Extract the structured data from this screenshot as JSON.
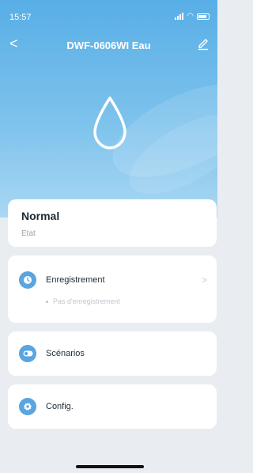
{
  "status_bar": {
    "time": "15:57"
  },
  "header": {
    "back_label": "<",
    "title": "DWF-0606WI Eau"
  },
  "device_icon": "water-drop-icon",
  "state_card": {
    "value": "Normal",
    "label": "Etat"
  },
  "menu": [
    {
      "label": "Enregistrement",
      "icon": "clock-icon",
      "sub": "Pas d'enregistrement",
      "chevron": ">"
    },
    {
      "label": "Scénarios",
      "icon": "toggle-icon"
    },
    {
      "label": "Config.",
      "icon": "gear-icon"
    }
  ],
  "colors": {
    "accent": "#5aa4e0",
    "hero_top": "#58aee6",
    "hero_bottom": "#a9d7f3"
  }
}
